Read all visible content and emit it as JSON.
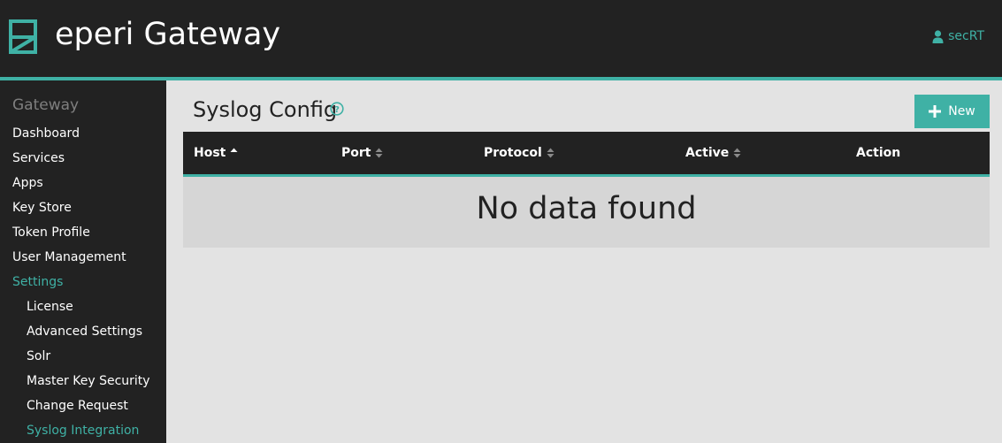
{
  "header": {
    "title": "eperi Gateway",
    "user": "secRT",
    "logo_icon": "eperi-logo-icon",
    "user_icon": "user-icon"
  },
  "colors": {
    "accent": "#3fb1a5",
    "dark": "#222222",
    "background": "#e3e3e3"
  },
  "sidebar": {
    "heading": "Gateway",
    "items": [
      {
        "label": "Dashboard"
      },
      {
        "label": "Services"
      },
      {
        "label": "Apps"
      },
      {
        "label": "Key Store"
      },
      {
        "label": "Token Profile"
      },
      {
        "label": "User Management"
      },
      {
        "label": "Settings"
      },
      {
        "label": "License"
      },
      {
        "label": "Advanced Settings"
      },
      {
        "label": "Solr"
      },
      {
        "label": "Master Key Security"
      },
      {
        "label": "Change Request"
      },
      {
        "label": "Syslog Integration"
      }
    ]
  },
  "main": {
    "title": "Syslog Config",
    "new_button": "New",
    "table": {
      "columns": [
        {
          "label": "Host",
          "sort": "ascending"
        },
        {
          "label": "Port",
          "sort": "both"
        },
        {
          "label": "Protocol",
          "sort": "both"
        },
        {
          "label": "Active",
          "sort": "both"
        },
        {
          "label": "Action",
          "sort": "none"
        }
      ],
      "empty_message": "No data found"
    }
  }
}
